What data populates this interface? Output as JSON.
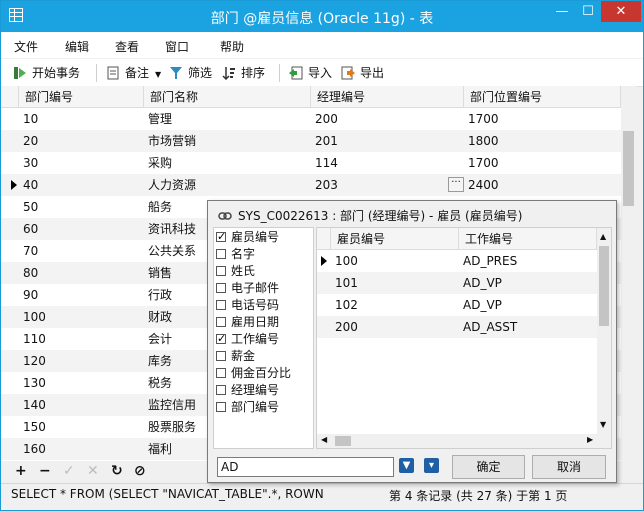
{
  "window": {
    "title": "部门 @雇员信息 (Oracle 11g) - 表",
    "minimize_glyph": "—",
    "maximize_glyph": "☐",
    "close_glyph": "✕",
    "icon": "table-grid-icon"
  },
  "menu": [
    "文件",
    "编辑",
    "查看",
    "窗口",
    "帮助"
  ],
  "toolbar": {
    "begin_transaction": "开始事务",
    "note": "备注",
    "filter": "筛选",
    "sort": "排序",
    "import": "导入",
    "export": "导出"
  },
  "grid": {
    "columns": [
      "部门编号",
      "部门名称",
      "经理编号",
      "部门位置编号"
    ],
    "rows": [
      [
        "10",
        "管理",
        "200",
        "1700"
      ],
      [
        "20",
        "市场营销",
        "201",
        "1800"
      ],
      [
        "30",
        "采购",
        "114",
        "1700"
      ],
      [
        "40",
        "人力资源",
        "203",
        "2400"
      ],
      [
        "50",
        "船务",
        "",
        ""
      ],
      [
        "60",
        "资讯科技",
        "",
        ""
      ],
      [
        "70",
        "公共关系",
        "",
        ""
      ],
      [
        "80",
        "销售",
        "",
        ""
      ],
      [
        "90",
        "行政",
        "",
        ""
      ],
      [
        "100",
        "财政",
        "",
        ""
      ],
      [
        "110",
        "会计",
        "",
        ""
      ],
      [
        "120",
        "库务",
        "",
        ""
      ],
      [
        "130",
        "税务",
        "",
        ""
      ],
      [
        "140",
        "监控信用",
        "",
        ""
      ],
      [
        "150",
        "股票服务",
        "",
        ""
      ],
      [
        "160",
        "福利",
        "",
        ""
      ]
    ],
    "current_row": 3,
    "ellipsis": "···"
  },
  "popup": {
    "title": "SYS_C0022613 : 部门 (经理编号) - 雇员 (雇员编号)",
    "fields": [
      {
        "label": "雇员编号",
        "checked": true
      },
      {
        "label": "名字",
        "checked": false
      },
      {
        "label": "姓氏",
        "checked": false
      },
      {
        "label": "电子邮件",
        "checked": false
      },
      {
        "label": "电话号码",
        "checked": false
      },
      {
        "label": "雇用日期",
        "checked": false
      },
      {
        "label": "工作编号",
        "checked": true
      },
      {
        "label": "薪金",
        "checked": false
      },
      {
        "label": "佣金百分比",
        "checked": false
      },
      {
        "label": "经理编号",
        "checked": false
      },
      {
        "label": "部门编号",
        "checked": false
      }
    ],
    "columns": [
      "雇员编号",
      "工作编号"
    ],
    "rows": [
      [
        "100",
        "AD_PRES"
      ],
      [
        "101",
        "AD_VP"
      ],
      [
        "102",
        "AD_VP"
      ],
      [
        "200",
        "AD_ASST"
      ]
    ],
    "filter_value": "AD",
    "ok": "确定",
    "cancel": "取消"
  },
  "navbar": [
    "+",
    "−",
    "✓",
    "✕",
    "↻",
    "⊘"
  ],
  "status": {
    "sql": "SELECT * FROM (SELECT \"NAVICAT_TABLE\".*, ROWN",
    "record": "第 4 条记录 (共 27 条) 于第 1 页"
  }
}
